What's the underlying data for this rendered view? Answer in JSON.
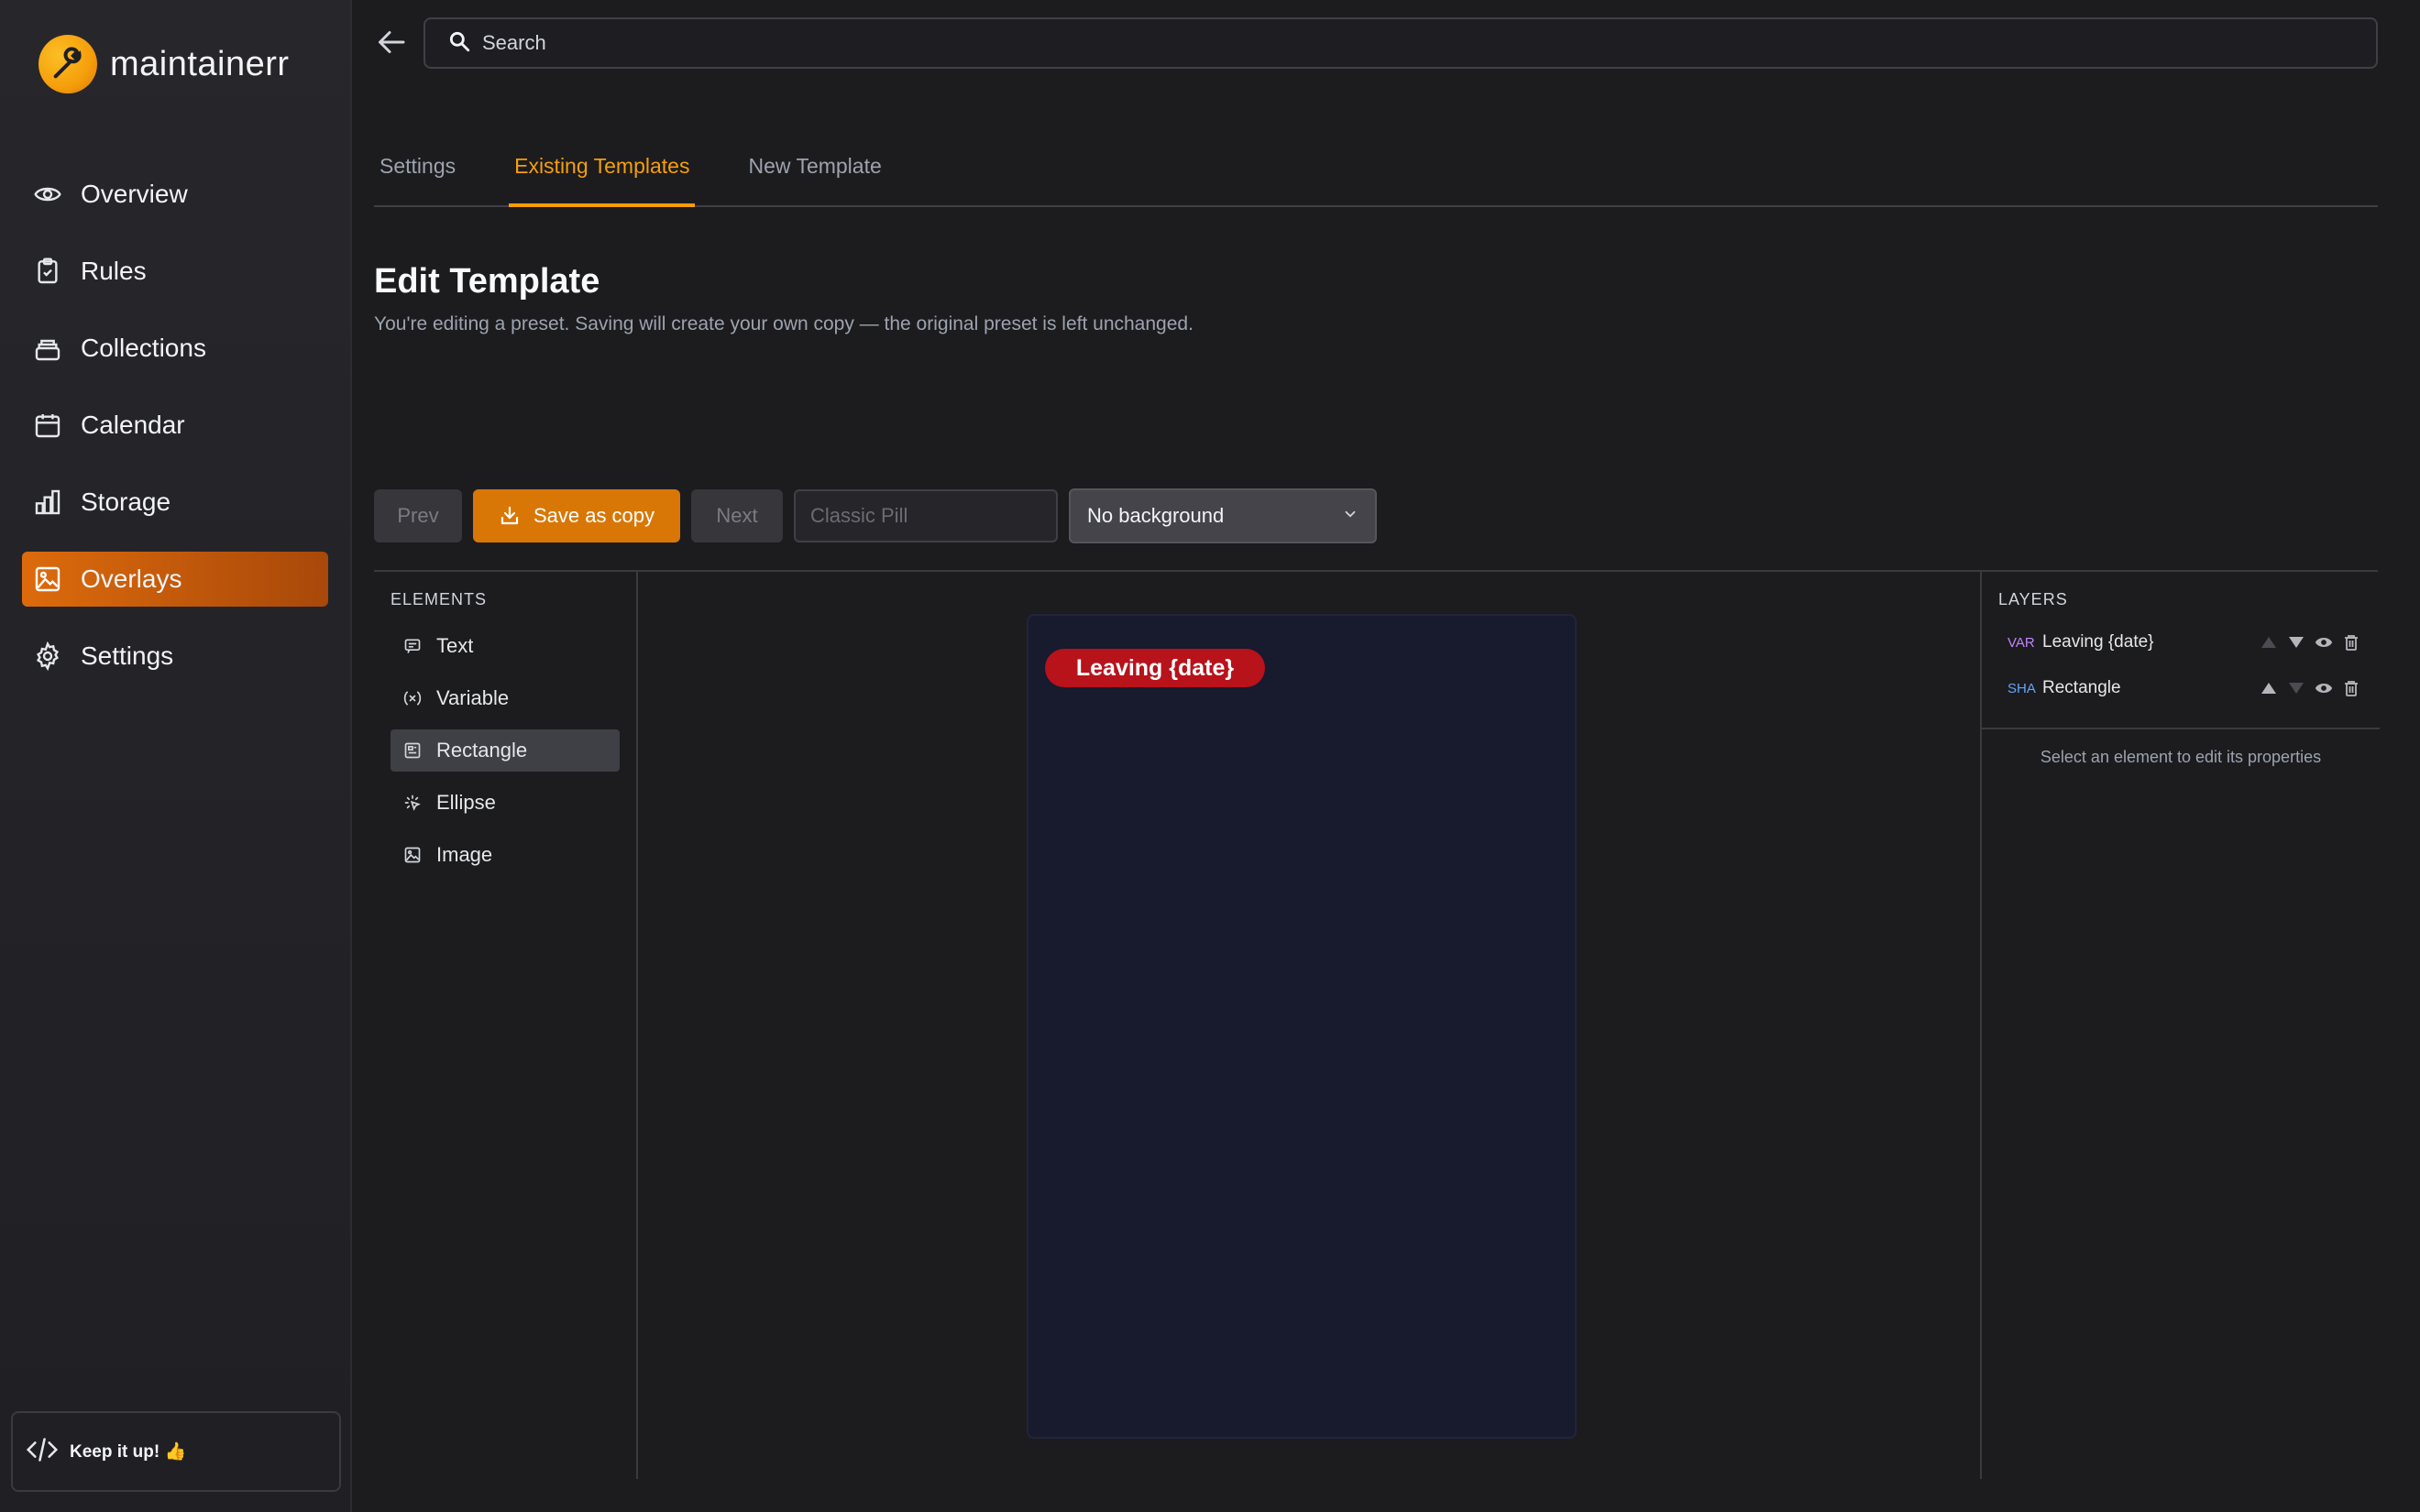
{
  "app": {
    "name": "maintainerr"
  },
  "sidebar": {
    "items": [
      {
        "label": "Overview",
        "icon": "eye-icon"
      },
      {
        "label": "Rules",
        "icon": "clipboard-check-icon"
      },
      {
        "label": "Collections",
        "icon": "stack-icon"
      },
      {
        "label": "Calendar",
        "icon": "calendar-icon"
      },
      {
        "label": "Storage",
        "icon": "bar-chart-icon"
      },
      {
        "label": "Overlays",
        "icon": "image-icon",
        "active": true
      },
      {
        "label": "Settings",
        "icon": "gear-icon"
      }
    ],
    "footer": "Keep it up! 👍"
  },
  "search": {
    "placeholder": "Search"
  },
  "tabs": [
    {
      "label": "Settings"
    },
    {
      "label": "Existing Templates",
      "active": true
    },
    {
      "label": "New Template"
    }
  ],
  "page": {
    "title": "Edit Template",
    "subtitle": "You're editing a preset. Saving will create your own copy — the original preset is left unchanged."
  },
  "toolbar": {
    "prev_label": "Prev",
    "save_label": "Save as copy",
    "next_label": "Next",
    "name_placeholder": "Classic Pill",
    "background_value": "No background"
  },
  "elements": {
    "heading": "ELEMENTS",
    "items": [
      {
        "label": "Text",
        "icon": "text-icon"
      },
      {
        "label": "Variable",
        "icon": "variable-icon"
      },
      {
        "label": "Rectangle",
        "icon": "rectangle-icon",
        "selected": true
      },
      {
        "label": "Ellipse",
        "icon": "ellipse-icon"
      },
      {
        "label": "Image",
        "icon": "image-icon"
      }
    ]
  },
  "canvas": {
    "pill_text": "Leaving {date}",
    "background_color": "#181a2e",
    "pill_color": "#b8121b"
  },
  "layers": {
    "heading": "LAYERS",
    "items": [
      {
        "tag": "VAR",
        "name": "Leaving {date}"
      },
      {
        "tag": "SHA",
        "name": "Rectangle"
      }
    ],
    "hint": "Select an element to edit its properties"
  },
  "colors": {
    "accent": "#d97706",
    "active_nav": "#dd6b0c"
  }
}
